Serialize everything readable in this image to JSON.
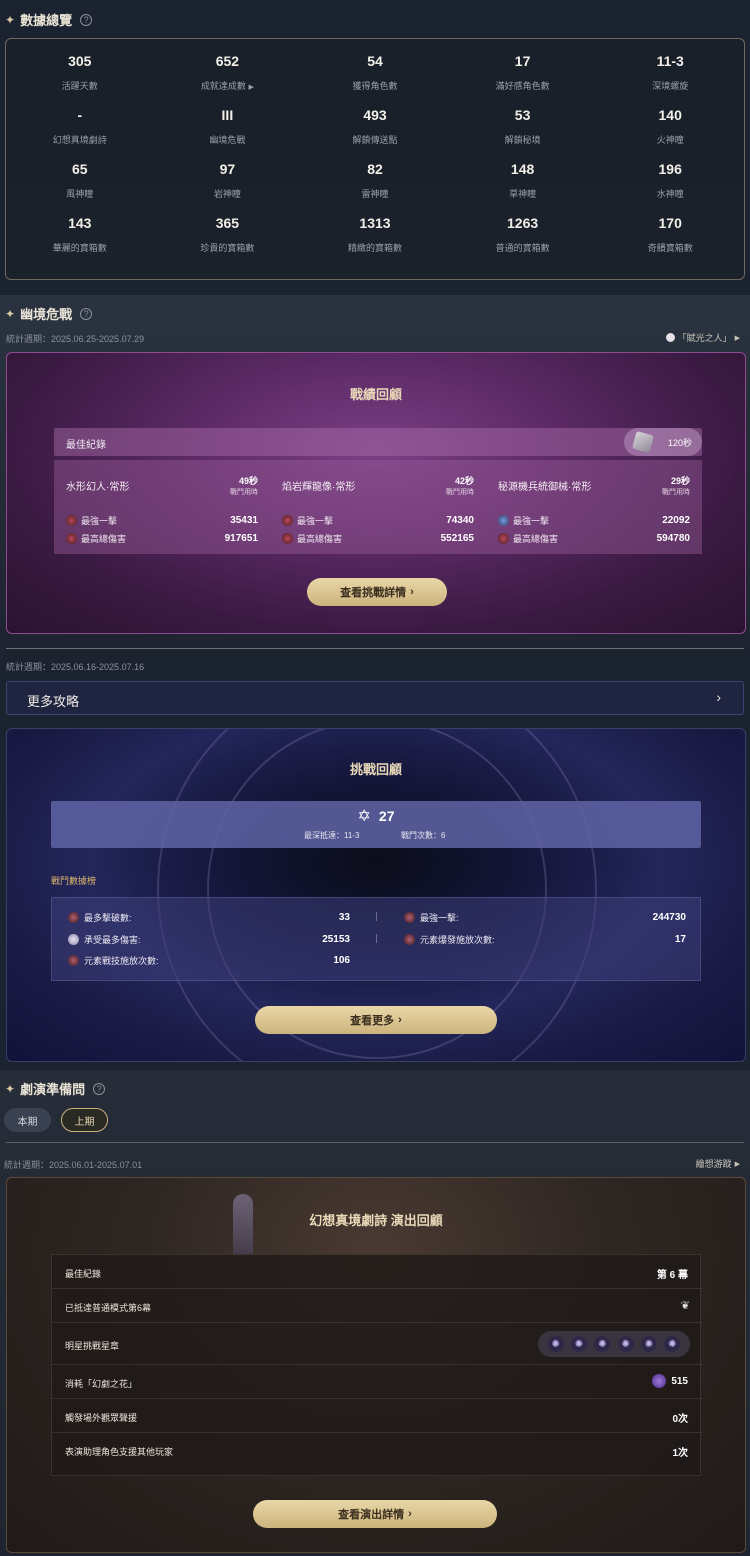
{
  "overview": {
    "title": "數據總覽",
    "help": "?",
    "stats": [
      {
        "value": "305",
        "label": "活躍天數"
      },
      {
        "value": "652",
        "label": "成就達成數"
      },
      {
        "value": "54",
        "label": "獲得角色數"
      },
      {
        "value": "17",
        "label": "滿好感角色數"
      },
      {
        "value": "11-3",
        "label": "深境螺旋"
      },
      {
        "value": "-",
        "label": "幻想真境劇詩"
      },
      {
        "value": "III",
        "label": "幽境危戰"
      },
      {
        "value": "493",
        "label": "解鎖傳送點"
      },
      {
        "value": "53",
        "label": "解鎖秘境"
      },
      {
        "value": "140",
        "label": "火神瞳"
      },
      {
        "value": "65",
        "label": "風神瞳"
      },
      {
        "value": "97",
        "label": "岩神瞳"
      },
      {
        "value": "82",
        "label": "雷神瞳"
      },
      {
        "value": "148",
        "label": "草神瞳"
      },
      {
        "value": "196",
        "label": "水神瞳"
      },
      {
        "value": "143",
        "label": "華麗的寶箱數"
      },
      {
        "value": "365",
        "label": "珍貴的寶箱數"
      },
      {
        "value": "1313",
        "label": "精緻的寶箱數"
      },
      {
        "value": "1263",
        "label": "普通的寶箱數"
      },
      {
        "value": "170",
        "label": "奇饋寶箱數"
      }
    ]
  },
  "abyss": {
    "title": "幽境危戰",
    "help": "?",
    "period": "統計週期：2025.06.25-2025.07.29",
    "link": "「賦光之人」",
    "panel_title": "戰績回顧",
    "best_label": "最佳紀錄",
    "best_time": "120秒",
    "bosses": [
      {
        "name": "水形幻人·常形",
        "seconds": "49秒",
        "sec_label": "戰鬥用時",
        "r1_label": "最強一擊",
        "r1": "35431",
        "r2_label": "最高總傷害",
        "r2": "917651"
      },
      {
        "name": "焰岩輝龍像·常形",
        "seconds": "42秒",
        "sec_label": "戰鬥用時",
        "r1_label": "最強一擊",
        "r1": "74340",
        "r2_label": "最高總傷害",
        "r2": "552165"
      },
      {
        "name": "秘源機兵統御械·常形",
        "seconds": "29秒",
        "sec_label": "戰鬥用時",
        "r1_label": "最強一擊",
        "r1": "22092",
        "r2_label": "最高總傷害",
        "r2": "594780"
      }
    ],
    "button": "查看挑戰詳情"
  },
  "spiral": {
    "period": "統計週期：2025.06.16-2025.07.16",
    "more_label": "更多攻略",
    "panel_title": "挑戰回顧",
    "stars": "27",
    "deepest_label": "最深抵達：",
    "deepest": "11-3",
    "battles_label": "戰鬥次數：",
    "battles": "6",
    "rank_title": "戰鬥數據榜",
    "ranks": [
      {
        "label": "最多擊破數:",
        "value": "33"
      },
      {
        "label": "最強一擊:",
        "value": "244730"
      },
      {
        "label": "承受最多傷害:",
        "value": "25153"
      },
      {
        "label": "元素爆發施放次數:",
        "value": "17"
      },
      {
        "label": "元素戰技施放次數:",
        "value": "106"
      }
    ],
    "button": "查看更多"
  },
  "theater": {
    "title": "劇演準備問",
    "help": "?",
    "tabs": [
      "本期",
      "上期"
    ],
    "period": "統計週期：2025.06.01-2025.07.01",
    "link": "繪想游蹤",
    "panel_title": "幻想真境劇詩 演出回顧",
    "rows": [
      {
        "label": "最佳紀錄",
        "value": "第 6 幕"
      },
      {
        "label": "已抵達普通模式第6幕",
        "value": ""
      },
      {
        "label": "明星挑戰星章",
        "value": ""
      },
      {
        "label": "消耗「幻劇之花」",
        "value": "515"
      },
      {
        "label": "觸發場外觀眾聲援",
        "value": "0次"
      },
      {
        "label": "表演助理角色支援其他玩家",
        "value": "1次"
      }
    ],
    "button": "查看演出詳情"
  }
}
